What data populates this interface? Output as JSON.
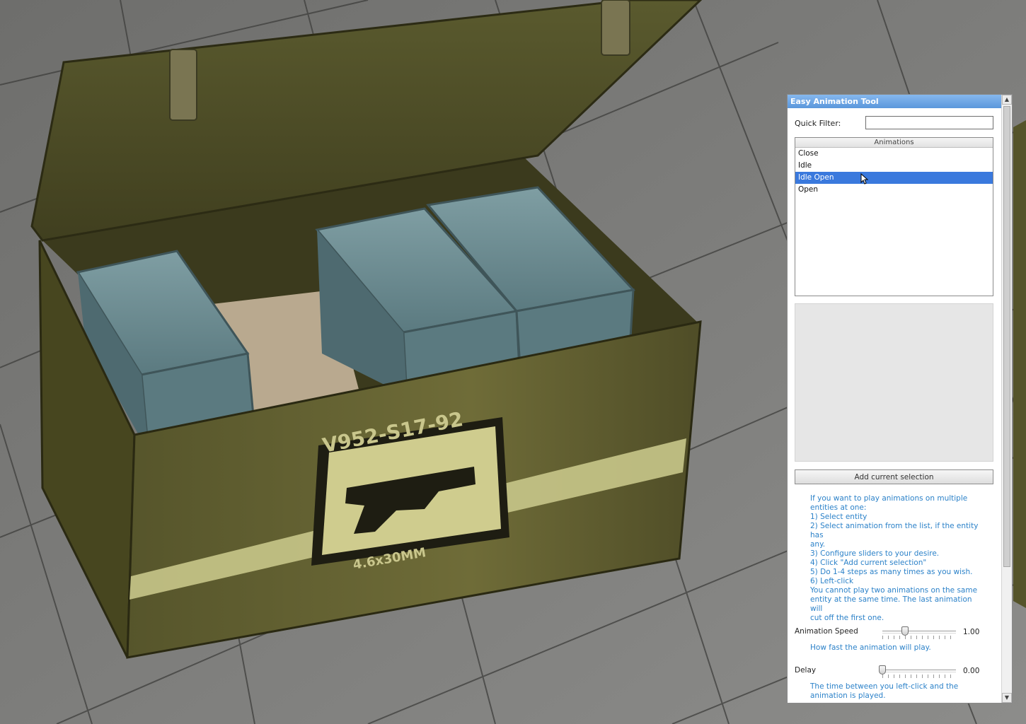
{
  "panel": {
    "title": "Easy Animation Tool",
    "filter_label": "Quick Filter:",
    "filter_value": "",
    "list_header": "Animations",
    "animations": [
      "Close",
      "Idle",
      "Idle Open",
      "Open"
    ],
    "selected_animation": "Idle Open",
    "add_button": "Add current selection",
    "help_lines": [
      "If you want to play animations on multiple",
      "entities at one:",
      "1) Select entity",
      "2) Select animation from the list, if the entity has",
      "any.",
      "3) Configure sliders to your desire.",
      "4) Click \"Add current selection\"",
      "5) Do 1-4 steps as many times as you wish.",
      "6) Left-click"
    ],
    "help2_lines": [
      "You cannot play two animations on the same",
      "entity at the same time. The last animation will",
      "cut off the first one."
    ],
    "speed": {
      "label": "Animation Speed",
      "value": "1.00",
      "help": "How fast the animation will play."
    },
    "delay": {
      "label": "Delay",
      "value": "0.00",
      "help_lines": [
        "The time between you left-click and the",
        "animation is played."
      ]
    }
  },
  "scene": {
    "crate_code": "V952-S17-92",
    "crate_caliber": "4.6x30MM"
  },
  "colors": {
    "title_bar": "#5a97dc",
    "selection": "#3a79dd",
    "help_text": "#2c82c9",
    "crate_olive": "#5e5c2c",
    "crate_stripe": "#c8c68a",
    "ammo_box": "#6f8f95"
  }
}
